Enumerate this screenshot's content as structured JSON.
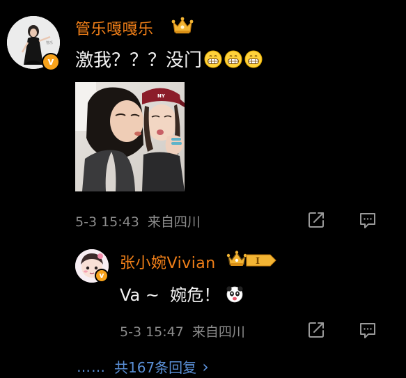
{
  "post": {
    "username": "管乐嘎嘎乐",
    "text": "激我？？？没门",
    "emoji_count": 3,
    "emoji_icon": "grin-emoji",
    "timestamp": "5-3 15:43",
    "source": "来自四川",
    "brand_color": "#f07f18",
    "verified_color": "#f7a21b"
  },
  "reply": {
    "username": "张小婉Vivian",
    "level": "I",
    "text": "Va ~  婉危！",
    "emoji_icon": "panda-emoji",
    "timestamp": "5-3 15:47",
    "source": "来自四川"
  },
  "more_replies": {
    "dots": "……",
    "label": "共167条回复",
    "chevron": "›",
    "link_color": "#5a8fd6"
  }
}
